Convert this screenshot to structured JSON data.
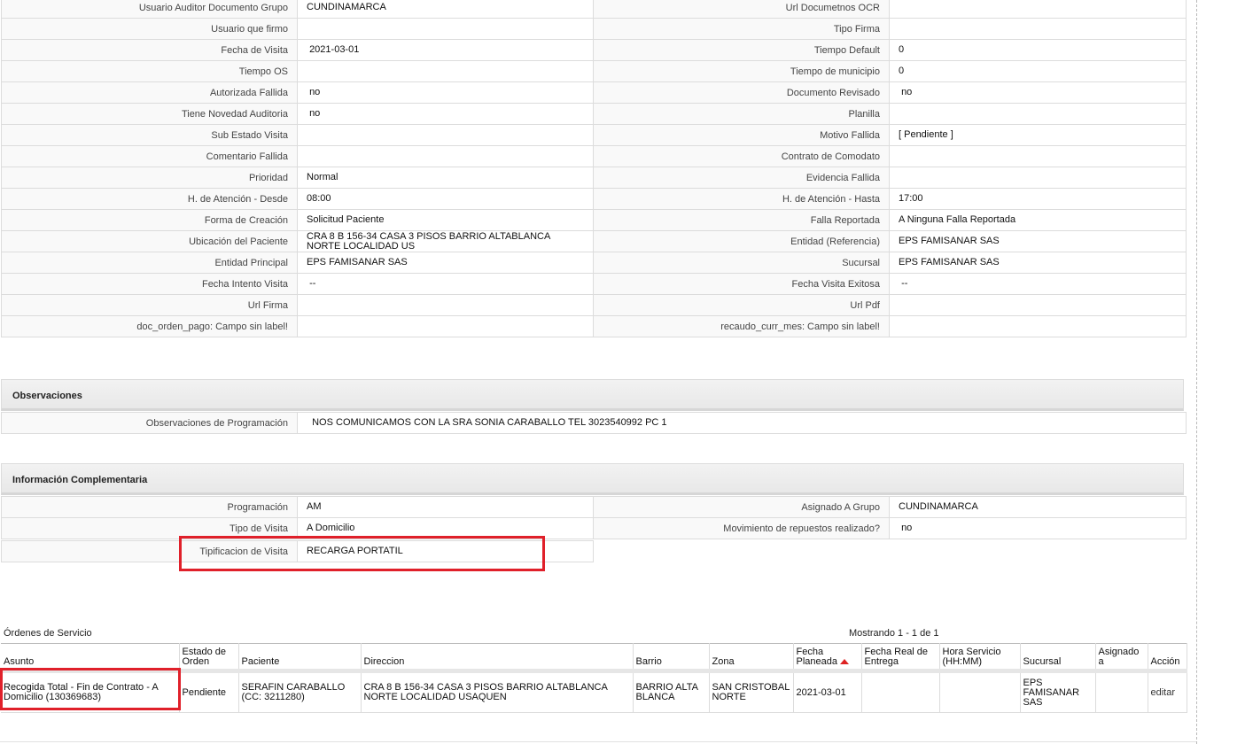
{
  "detail_rows": [
    [
      "Usuario Auditor Documento Grupo",
      "CUNDINAMARCA",
      "Url Documetnos OCR",
      ""
    ],
    [
      "Usuario que firmo",
      "",
      "Tipo Firma",
      ""
    ],
    [
      "Fecha de Visita",
      " 2021-03-01",
      "Tiempo Default",
      "0"
    ],
    [
      "Tiempo OS",
      "",
      "Tiempo de municipio",
      "0"
    ],
    [
      "Autorizada Fallida",
      " no",
      "Documento Revisado",
      " no"
    ],
    [
      "Tiene Novedad Auditoria",
      " no",
      "Planilla",
      ""
    ],
    [
      "Sub Estado Visita",
      "",
      "Motivo Fallida",
      "[ Pendiente ]"
    ],
    [
      "Comentario Fallida",
      "",
      "Contrato de Comodato",
      ""
    ],
    [
      "Prioridad",
      "Normal",
      "Evidencia Fallida",
      ""
    ],
    [
      "H. de Atención - Desde",
      "08:00",
      "H. de Atención - Hasta",
      "17:00"
    ],
    [
      "Forma de Creación",
      "Solicitud Paciente",
      "Falla Reportada",
      "A Ninguna Falla Reportada"
    ],
    [
      "Ubicación del Paciente",
      "CRA 8 B 156-34 CASA 3 PISOS BARRIO ALTABLANCA NORTE LOCALIDAD US",
      "Entidad (Referencia)",
      "EPS FAMISANAR SAS"
    ],
    [
      "Entidad Principal",
      "EPS FAMISANAR SAS",
      "Sucursal",
      "EPS FAMISANAR SAS"
    ],
    [
      "Fecha Intento Visita",
      " --",
      "Fecha Visita Exitosa",
      " --"
    ],
    [
      "Url Firma",
      "",
      "Url Pdf",
      ""
    ],
    [
      "doc_orden_pago: Campo sin label!",
      "",
      "recaudo_curr_mes: Campo sin label!",
      ""
    ]
  ],
  "observaciones": {
    "title": "Observaciones",
    "label": "Observaciones de Programación",
    "value": "  NOS COMUNICAMOS CON LA SRA SONIA CARABALLO TEL 3023540992 PC 1"
  },
  "complementaria": {
    "title": "Información Complementaria",
    "rows": [
      [
        "Programación",
        "AM",
        "Asignado A Grupo",
        "CUNDINAMARCA"
      ],
      [
        "Tipo de Visita",
        "A Domicilio",
        "Movimiento de repuestos realizado?",
        " no"
      ]
    ],
    "tipificacion_label": "Tipificacion de Visita",
    "tipificacion_value": "RECARGA PORTATIL"
  },
  "orders": {
    "title": "Órdenes de Servicio",
    "count": "Mostrando 1 - 1 de 1",
    "headers": [
      "Asunto",
      "Estado de Orden",
      "Paciente",
      "Direccion",
      "Barrio",
      "Zona",
      "Fecha Planeada",
      "Fecha Real de Entrega",
      "Hora Servicio (HH:MM)",
      "Sucursal",
      "Asignado a",
      "Acción"
    ],
    "rows": [
      [
        "Recogida Total - Fin de Contrato - A Domicilio (130369683)",
        "Pendiente",
        "SERAFIN CARABALLO (CC: 3211280)",
        "CRA 8 B 156-34 CASA 3 PISOS BARRIO ALTABLANCA NORTE LOCALIDAD USAQUEN",
        "BARRIO ALTA BLANCA",
        "SAN CRISTOBAL NORTE",
        "2021-03-01",
        "",
        "",
        "EPS FAMISANAR SAS",
        "",
        "editar"
      ]
    ]
  },
  "colors": {
    "highlight": "#e0202a",
    "sort_arrow": "#d22222"
  }
}
